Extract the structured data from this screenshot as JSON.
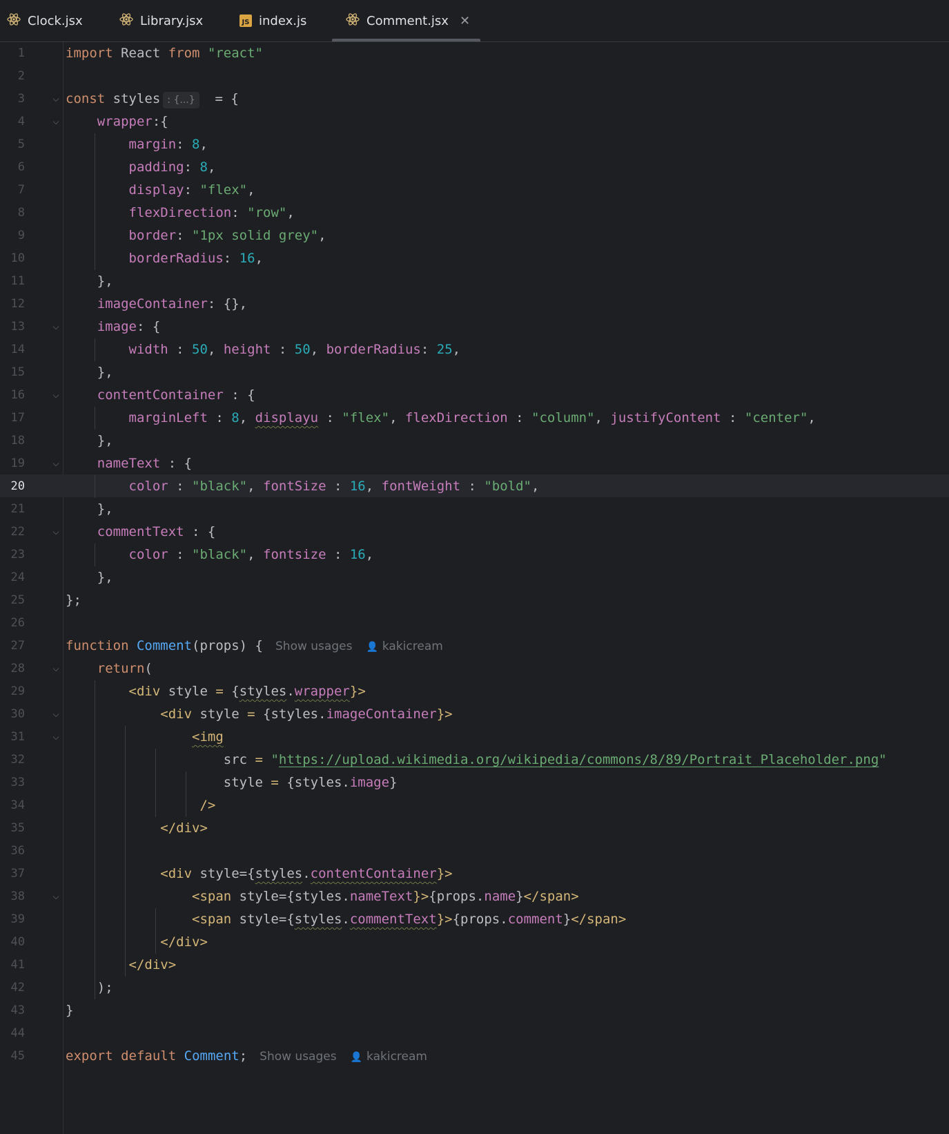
{
  "tabs": [
    {
      "label": "Clock.jsx",
      "icon": "react-icon"
    },
    {
      "label": "Library.jsx",
      "icon": "react-icon"
    },
    {
      "label": "index.js",
      "icon": "js-icon"
    },
    {
      "label": "Comment.jsx",
      "icon": "react-icon",
      "active": true,
      "close": "✕"
    }
  ],
  "js_badge": "JS",
  "editor": {
    "current_line": 20,
    "collapsed_hint": ": {...}",
    "code_lens": {
      "show_usages": "Show usages",
      "author": "kakicream"
    },
    "line_numbers": [
      "1",
      "2",
      "3",
      "4",
      "5",
      "6",
      "7",
      "8",
      "9",
      "10",
      "11",
      "12",
      "13",
      "14",
      "15",
      "16",
      "17",
      "18",
      "19",
      "20",
      "21",
      "22",
      "23",
      "24",
      "25",
      "26",
      "27",
      "28",
      "29",
      "30",
      "31",
      "32",
      "33",
      "34",
      "35",
      "36",
      "37",
      "38",
      "39",
      "40",
      "41",
      "42",
      "43",
      "44",
      "45"
    ],
    "tokens": {
      "import": "import",
      "react_id": " React ",
      "from": "from",
      "react_str": " \"react\"",
      "const": "const",
      "styles": " styles",
      "eq_open": "  = {",
      "wrapper": "wrapper",
      "wrapper_tail": ":{",
      "margin": "margin",
      "colon": ": ",
      "n8": "8",
      "comma": ",",
      "padding": "padding",
      "display": "display",
      "flex_str": "\"flex\"",
      "flexDirection": "flexDirection",
      "row_str": "\"row\"",
      "border": "border",
      "border_str": "\"1px solid grey\"",
      "borderRadius": "borderRadius",
      "n16": "16",
      "close_brace_comma": "},",
      "imageContainer": "imageContainer",
      "empty_obj": ": {},",
      "image": "image",
      "open_obj": ": {",
      "width": "width",
      "sp_colon": " : ",
      "n50": "50",
      "comma_sp": ", ",
      "height": "height",
      "n25": "25",
      "contentContainer": "contentContainer",
      "sp_open_obj": " : {",
      "marginLeft": "marginLeft",
      "displayu": "displayu",
      "column_str": "\"column\"",
      "justifyContent": "justifyContent",
      "center_str": "\"center\"",
      "nameText": "nameText",
      "color": "color",
      "black_str": "\"black\"",
      "fontSize": "fontSize",
      "fontWeight": "fontWeight",
      "bold_str": "\"bold\"",
      "commentText": "commentText",
      "fontsize": "fontsize",
      "end_obj": "};",
      "function": "function",
      "Comment": "Comment",
      "props_sig": "(props) {",
      "return": "return",
      "paren_open": "(",
      "div_open": "<div",
      "style_kw": " style ",
      "eq": "=",
      "brace_open": " {",
      "styles_ref": "styles",
      "dot": ".",
      "wrapper_ref": "wrapper",
      "close_tag": "}>",
      "style_eq": " style=",
      "lbrace": "{",
      "img_open": "<img",
      "src": "src",
      "eq_sp": " = ",
      "url": "https://upload.wikimedia.org/wikipedia/commons/8/89/Portrait_Placeholder.png",
      "quote": "\"",
      "style_plain": "style",
      "image_ref": "image",
      "rbrace": "}",
      "self_close": "/>",
      "div_close": "</div>",
      "span_open": "<span",
      "nameText_ref": "nameText",
      "gt": ">",
      "props_ref": "props",
      "name_ref": "name",
      "span_close": "</span>",
      "commentText_ref": "commentText",
      "comment_ref": "comment",
      "rparen_semi": ");",
      "close_fn": "}",
      "export": "export",
      "default": "default",
      "semi": ";"
    }
  }
}
